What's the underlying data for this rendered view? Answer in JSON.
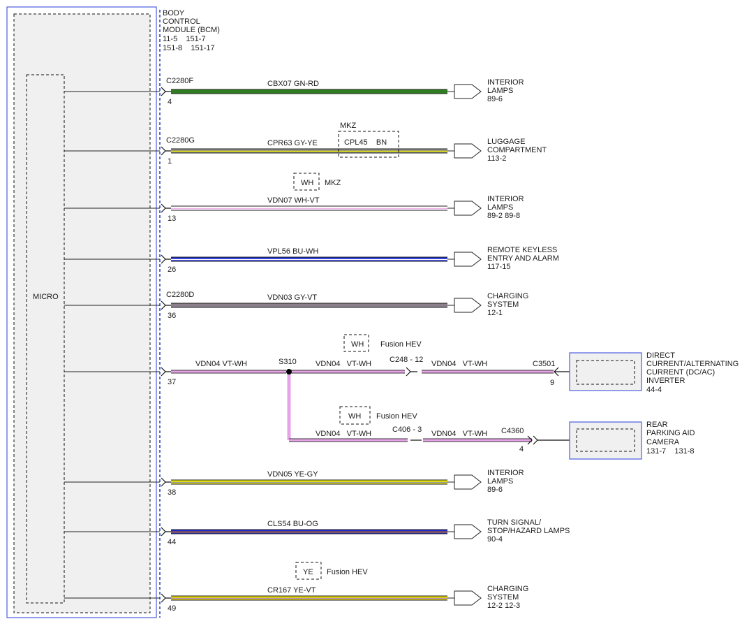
{
  "module": {
    "lines": [
      "BODY",
      "CONTROL",
      "MODULE (BCM)",
      "11-5    151-7",
      "151-8    151-17"
    ],
    "micro_label": "MICRO"
  },
  "circuits": [
    {
      "id": "c1",
      "pin": "4",
      "connector": "C2280F",
      "wire_label": "CBX07   GN-RD",
      "wire_colors": [
        "#2e7d1f"
      ],
      "dest_lines": [
        "INTERIOR",
        "LAMPS",
        "89-6"
      ]
    },
    {
      "id": "c2",
      "pin": "1",
      "connector": "C2280G",
      "wire_label": "CPR63   GY-YE",
      "wire_colors": [
        "#8a8a8a",
        "#e8e800"
      ],
      "dest_lines": [
        "LUGGAGE",
        "COMPARTMENT",
        "113-2"
      ],
      "option_title": "MKZ",
      "option_wire_label": "CPL45    BN"
    },
    {
      "id": "c3",
      "pin": "13",
      "connector": "",
      "wire_label": "VDN07   WH-VT",
      "wire_colors": [
        "#ffffff",
        "#f2b3ee"
      ],
      "dest_lines": [
        "INTERIOR",
        "LAMPS",
        "89-2    89-8"
      ],
      "note_box": "WH",
      "note_text": "MKZ"
    },
    {
      "id": "c4",
      "pin": "26",
      "connector": "",
      "wire_label": "VPL56   BU-WH",
      "wire_colors": [
        "#1c2bd1",
        "#ffffff"
      ],
      "dest_lines": [
        "REMOTE KEYLESS",
        "ENTRY AND ALARM",
        "117-15"
      ]
    },
    {
      "id": "c5",
      "pin": "36",
      "connector": "C2280D",
      "wire_label": "VDN03   GY-VT",
      "wire_colors": [
        "#8c7f8c"
      ],
      "dest_lines": [
        "CHARGING",
        "SYSTEM",
        "12-1"
      ]
    },
    {
      "id": "c6",
      "pin": "37",
      "connector": "",
      "wire_label": "VDN04   VT-WH",
      "wire_colors": [
        "#e8a3e8"
      ],
      "dest_lines": [],
      "note_box": "WH",
      "note_text": "Fusion HEV"
    },
    {
      "id": "c7",
      "pin": "38",
      "connector": "",
      "wire_label": "VDN05   YE-GY",
      "wire_colors": [
        "#e8e800",
        "#9a9a9a"
      ],
      "dest_lines": [
        "INTERIOR",
        "LAMPS",
        "89-6"
      ]
    },
    {
      "id": "c8",
      "pin": "44",
      "connector": "",
      "wire_label": "CLS54   BU-OG",
      "wire_colors": [
        "#1c2bd1",
        "#e07a00"
      ],
      "dest_lines": [
        "TURN SIGNAL/",
        "STOP/HAZARD LAMPS",
        "90-4"
      ]
    },
    {
      "id": "c9",
      "pin": "49",
      "connector": "",
      "wire_label": "CR167   YE-VT",
      "wire_colors": [
        "#e0d800",
        "#b58ab5"
      ],
      "dest_lines": [
        "CHARGING",
        "SYSTEM",
        "12-2    12-3"
      ],
      "note_box": "YE",
      "note_text": "Fusion HEV"
    }
  ],
  "branch": {
    "splice": "S310",
    "seg2_label": "VDN04   VT-WH",
    "inline1_connector": "C248 - 12",
    "seg3_label": "VDN04   VT-WH",
    "dest1_connector": "C3501",
    "dest1_pin": "9",
    "dest1_lines": [
      "DIRECT",
      "CURRENT/ALTERNATING",
      "CURRENT (DC/AC)",
      "INVERTER",
      "44-4"
    ],
    "note2_box": "WH",
    "note2_text": "Fusion HEV",
    "seg4_label": "VDN04   VT-WH",
    "inline2_connector": "C406 - 3",
    "seg5_label": "VDN04   VT-WH",
    "dest2_connector": "C4360",
    "dest2_pin": "4",
    "dest2_lines": [
      "REAR",
      "PARKING AID",
      "CAMERA",
      "131-7    131-8"
    ]
  }
}
